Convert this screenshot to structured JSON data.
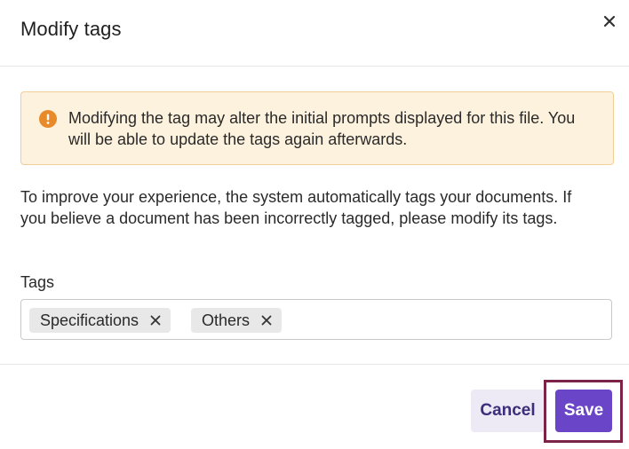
{
  "dialog": {
    "title": "Modify tags",
    "close_icon": "close-icon"
  },
  "alert": {
    "icon": "warning-circle-icon",
    "text": "Modifying the tag may alter the initial prompts displayed for this file. You will be able to update the tags again afterwards.",
    "background_color": "#fdf2de",
    "icon_color": "#e8892a"
  },
  "description": "To improve your experience, the system automatically tags your documents. If you believe a document has been incorrectly tagged, please modify its tags.",
  "tags": {
    "label": "Tags",
    "items": [
      {
        "label": "Specifications",
        "remove_icon": "close-icon"
      },
      {
        "label": "Others",
        "remove_icon": "close-icon"
      }
    ]
  },
  "footer": {
    "cancel_label": "Cancel",
    "save_label": "Save",
    "accent_color": "#6a45c7",
    "highlight_color": "#7d2348"
  }
}
